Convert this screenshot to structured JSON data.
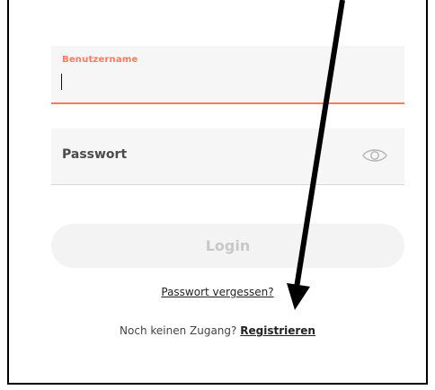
{
  "login_form": {
    "username": {
      "label": "Benutzername",
      "value": "",
      "accent_color": "#ff7a59"
    },
    "password": {
      "placeholder": "Passwort",
      "toggle_icon": "eye-icon"
    },
    "login_button": {
      "label": "Login"
    },
    "forgot_password": {
      "label": "Passwort vergessen?"
    },
    "register": {
      "prompt": "Noch keinen Zugang?",
      "link_label": "Registrieren"
    }
  }
}
